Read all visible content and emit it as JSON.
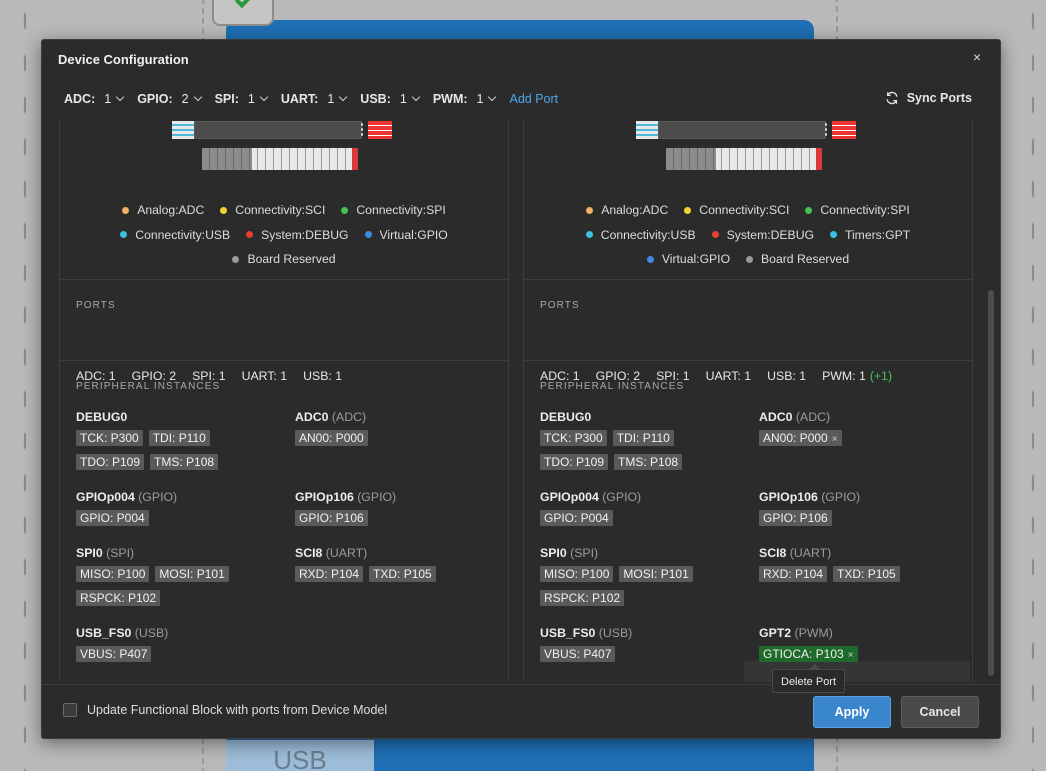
{
  "background": {
    "block_label": "USB"
  },
  "dialog": {
    "title": "Device Configuration",
    "close_glyph": "×"
  },
  "toolbar": {
    "counts": [
      {
        "label": "ADC:",
        "value": "1"
      },
      {
        "label": "GPIO:",
        "value": "2"
      },
      {
        "label": "SPI:",
        "value": "1"
      },
      {
        "label": "UART:",
        "value": "1"
      },
      {
        "label": "USB:",
        "value": "1"
      },
      {
        "label": "PWM:",
        "value": "1"
      }
    ],
    "add_port": "Add Port",
    "sync_ports": "Sync Ports"
  },
  "left": {
    "legend_rows": [
      [
        {
          "label": "Analog:ADC",
          "color": "#f0b060"
        },
        {
          "label": "Connectivity:SCI",
          "color": "#f2d230"
        },
        {
          "label": "Connectivity:SPI",
          "color": "#45c24e"
        }
      ],
      [
        {
          "label": "Connectivity:USB",
          "color": "#3cc0e0"
        },
        {
          "label": "System:DEBUG",
          "color": "#e8402e"
        },
        {
          "label": "Virtual:GPIO",
          "color": "#3c8ae0"
        }
      ],
      [
        {
          "label": "Board Reserved",
          "color": "#9a9a9a"
        }
      ]
    ],
    "ports_label": "PORTS",
    "ports": [
      "ADC: 1",
      "GPIO: 2",
      "SPI: 1",
      "UART: 1",
      "USB: 1"
    ],
    "instances_label": "PERIPHERAL INSTANCES",
    "instances": {
      "debug": {
        "name": "DEBUG0",
        "type": "",
        "tags": [
          "TCK: P300",
          "TDI: P110",
          "TDO: P109",
          "TMS: P108"
        ]
      },
      "adc": {
        "name": "ADC0",
        "type": "(ADC)",
        "tags": [
          "AN00: P000"
        ]
      },
      "gpio1": {
        "name": "GPIOp004",
        "type": "(GPIO)",
        "tags": [
          "GPIO: P004"
        ]
      },
      "gpio2": {
        "name": "GPIOp106",
        "type": "(GPIO)",
        "tags": [
          "GPIO: P106"
        ]
      },
      "spi": {
        "name": "SPI0",
        "type": "(SPI)",
        "tags": [
          "MISO: P100",
          "MOSI: P101",
          "RSPCK: P102"
        ]
      },
      "sci": {
        "name": "SCI8",
        "type": "(UART)",
        "tags": [
          "RXD: P104",
          "TXD: P105"
        ]
      },
      "usb": {
        "name": "USB_FS0",
        "type": "(USB)",
        "tags": [
          "VBUS: P407"
        ]
      }
    }
  },
  "right": {
    "legend_rows": [
      [
        {
          "label": "Analog:ADC",
          "color": "#f0b060"
        },
        {
          "label": "Connectivity:SCI",
          "color": "#f2d230"
        },
        {
          "label": "Connectivity:SPI",
          "color": "#45c24e"
        }
      ],
      [
        {
          "label": "Connectivity:USB",
          "color": "#3cc0e0"
        },
        {
          "label": "System:DEBUG",
          "color": "#e8402e"
        },
        {
          "label": "Timers:GPT",
          "color": "#3cc0e0"
        }
      ],
      [
        {
          "label": "Virtual:GPIO",
          "color": "#3c8ae0"
        },
        {
          "label": "Board Reserved",
          "color": "#9a9a9a"
        }
      ]
    ],
    "ports_label": "PORTS",
    "ports": [
      "ADC: 1",
      "GPIO: 2",
      "SPI: 1",
      "UART: 1",
      "USB: 1",
      "PWM: 1"
    ],
    "ports_delta": "(+1)",
    "instances_label": "PERIPHERAL INSTANCES",
    "instances": {
      "debug": {
        "name": "DEBUG0",
        "type": "",
        "tags": [
          "TCK: P300",
          "TDI: P110",
          "TDO: P109",
          "TMS: P108"
        ]
      },
      "adc": {
        "name": "ADC0",
        "type": "(ADC)",
        "tags": [
          "AN00: P000"
        ]
      },
      "gpio1": {
        "name": "GPIOp004",
        "type": "(GPIO)",
        "tags": [
          "GPIO: P004"
        ]
      },
      "gpio2": {
        "name": "GPIOp106",
        "type": "(GPIO)",
        "tags": [
          "GPIO: P106"
        ]
      },
      "spi": {
        "name": "SPI0",
        "type": "(SPI)",
        "tags": [
          "MISO: P100",
          "MOSI: P101",
          "RSPCK: P102"
        ]
      },
      "sci": {
        "name": "SCI8",
        "type": "(UART)",
        "tags": [
          "RXD: P104",
          "TXD: P105"
        ]
      },
      "usb": {
        "name": "USB_FS0",
        "type": "(USB)",
        "tags": [
          "VBUS: P407"
        ]
      },
      "gpt": {
        "name": "GPT2",
        "type": "(PWM)",
        "tags": [
          "GTIOCA: P103"
        ]
      }
    },
    "tag_remove_glyph": "×"
  },
  "footer": {
    "checkbox_label": "Update Functional Block with ports from Device Model",
    "apply": "Apply",
    "cancel": "Cancel",
    "tooltip": "Delete Port"
  }
}
